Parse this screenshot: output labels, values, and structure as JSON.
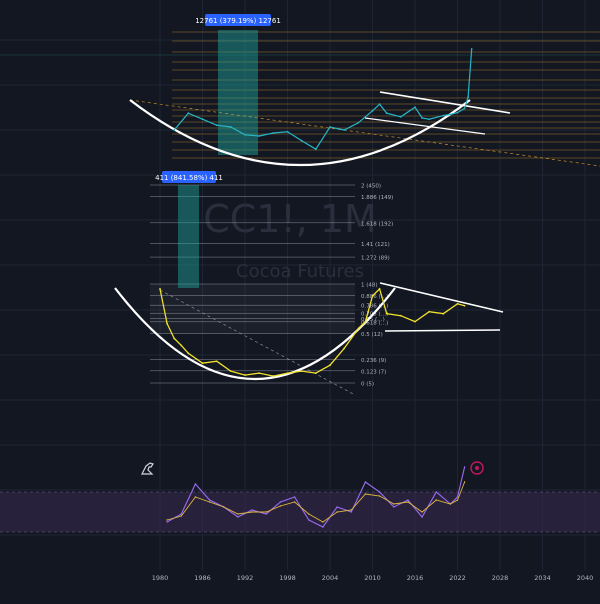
{
  "watermark": {
    "symbol": "CC1!, 1M",
    "name": "Cocoa Futures"
  },
  "colors": {
    "background": "#131722",
    "grid": "#1e2433",
    "fib_orange": "#c8902a",
    "teal_band": "#1fa8a0",
    "upper_line": "#25b7c9",
    "lower_line": "#f0e12c",
    "rsi_line": "#9a6df2",
    "rsi_signal": "#e0b93c",
    "rsi_band": "#3a2a52",
    "pattern_white": "#ffffff"
  },
  "chart_data": [
    {
      "type": "line",
      "role": "upper-price-panel",
      "measure_label": "12761 (379.19%) 12761",
      "series": [
        {
          "x": [
            1982,
            1984,
            1986,
            1988,
            1990,
            1992,
            1994,
            1996,
            1998,
            2000,
            2002,
            2004,
            2006,
            2008,
            2010,
            2011,
            2012,
            2014,
            2016,
            2017,
            2018,
            2020,
            2021,
            2022,
            2023,
            2023.5,
            2024
          ],
          "values": [
            0.5,
            0.78,
            0.68,
            0.58,
            0.55,
            0.42,
            0.4,
            0.45,
            0.47,
            0.32,
            0.18,
            0.55,
            0.5,
            0.62,
            0.82,
            0.93,
            0.78,
            0.72,
            0.88,
            0.7,
            0.68,
            0.74,
            0.76,
            0.79,
            0.86,
            1.05,
            1.85
          ]
        }
      ]
    },
    {
      "type": "line",
      "role": "lower-fib-panel",
      "measure_label": "411 (841.58%) 411",
      "fib_levels": [
        {
          "label": "2 (450)",
          "value": 2.0
        },
        {
          "label": "1.886 (149)",
          "value": 1.886
        },
        {
          "label": "1.618 (192)",
          "value": 1.618
        },
        {
          "label": "1.41 (121)",
          "value": 1.41
        },
        {
          "label": "1.272 (89)",
          "value": 1.272
        },
        {
          "label": "1 (48)",
          "value": 1.0
        },
        {
          "label": "0.886 (…)",
          "value": 0.886
        },
        {
          "label": "0.786 (…)",
          "value": 0.786
        },
        {
          "label": "0.705 (…)",
          "value": 0.705
        },
        {
          "label": "0.65 (…)",
          "value": 0.65
        },
        {
          "label": "0.618 (…)",
          "value": 0.618
        },
        {
          "label": "0.5 (12)",
          "value": 0.5
        },
        {
          "label": "0.236 (9)",
          "value": 0.236
        },
        {
          "label": "0.123 (7)",
          "value": 0.123
        },
        {
          "label": "0 (5)",
          "value": 0.0
        }
      ],
      "series": [
        {
          "x": [
            1980,
            1981,
            1982,
            1983,
            1984,
            1986,
            1988,
            1990,
            1992,
            1994,
            1996,
            1998,
            2000,
            2002,
            2004,
            2006,
            2008,
            2009,
            2010,
            2011,
            2012,
            2014,
            2016,
            2018,
            2020,
            2022,
            2023
          ],
          "values": [
            0.95,
            0.6,
            0.45,
            0.38,
            0.3,
            0.2,
            0.22,
            0.12,
            0.08,
            0.1,
            0.07,
            0.1,
            0.12,
            0.1,
            0.18,
            0.35,
            0.55,
            0.62,
            0.88,
            0.95,
            0.7,
            0.68,
            0.62,
            0.72,
            0.7,
            0.8,
            0.78
          ]
        }
      ]
    },
    {
      "type": "line",
      "role": "rsi-panel",
      "x": [
        1981,
        1983,
        1985,
        1987,
        1989,
        1991,
        1993,
        1995,
        1997,
        1999,
        2001,
        2003,
        2005,
        2007,
        2009,
        2011,
        2013,
        2015,
        2017,
        2019,
        2021,
        2022,
        2023
      ],
      "series": [
        {
          "values": [
            40,
            48,
            78,
            62,
            55,
            45,
            52,
            48,
            60,
            65,
            42,
            35,
            55,
            50,
            80,
            70,
            55,
            62,
            45,
            70,
            58,
            65,
            95
          ]
        },
        {
          "values": [
            42,
            46,
            65,
            60,
            55,
            48,
            50,
            50,
            56,
            60,
            48,
            40,
            50,
            52,
            68,
            66,
            58,
            60,
            50,
            62,
            58,
            62,
            80
          ]
        }
      ],
      "ylim": [
        0,
        100
      ],
      "band": [
        30,
        70
      ],
      "x_ticks": [
        "1980",
        "1986",
        "1992",
        "1998",
        "2004",
        "2010",
        "2016",
        "2022",
        "2028",
        "2034",
        "2040"
      ]
    }
  ]
}
